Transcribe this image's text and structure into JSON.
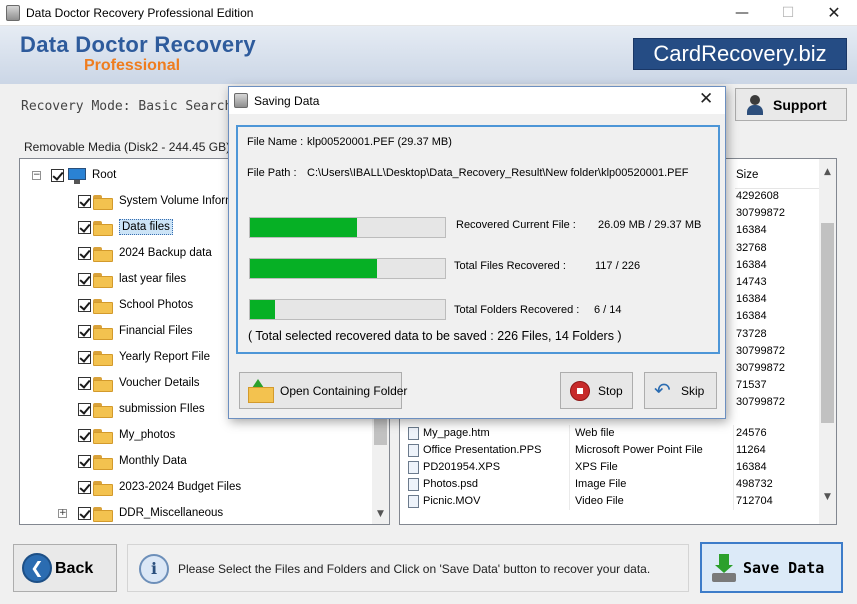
{
  "window": {
    "title": "Data Doctor Recovery Professional Edition",
    "minimize_glyph": "—",
    "maximize_glyph": "☐",
    "close_glyph": "✕"
  },
  "banner": {
    "brand_main": "Data Doctor Recovery",
    "brand_sub": "Professional",
    "site_badge": "CardRecovery.biz"
  },
  "header": {
    "recovery_mode": "Recovery Mode: Basic Search",
    "support_label": "Support"
  },
  "media_label": "Removable Media (Disk2 - 244.45 GB)",
  "tree": {
    "root": "Root",
    "expander_root": "−",
    "expander_last": "+",
    "items": [
      "System Volume Information",
      "Data files",
      "2024 Backup data",
      "last year files",
      "School Photos",
      "Financial Files",
      "Yearly Report File",
      "Voucher Details",
      "submission FIles",
      "My_photos",
      "Monthly Data",
      "2023-2024 Budget Files",
      "DDR_Miscellaneous"
    ],
    "selected_item": "Data files"
  },
  "file_list": {
    "size_header": "Size",
    "visible_sizes": [
      "4292608",
      "30799872",
      "16384",
      "32768",
      "16384",
      "14743",
      "16384",
      "16384",
      "73728",
      "30799872",
      "30799872",
      "71537",
      "30799872"
    ],
    "rows": [
      {
        "name": "My_page.htm",
        "type": "Web file",
        "size": "24576"
      },
      {
        "name": "Office Presentation.PPS",
        "type": "Microsoft Power Point File",
        "size": "11264"
      },
      {
        "name": "PD201954.XPS",
        "type": "XPS File",
        "size": "16384"
      },
      {
        "name": "Photos.psd",
        "type": "Image File",
        "size": "498732"
      },
      {
        "name": "Picnic.MOV",
        "type": "Video File",
        "size": "712704"
      }
    ]
  },
  "dialog": {
    "title": "Saving Data",
    "close_glyph": "✕",
    "file_name_label": "File Name :",
    "file_name_value": "klp00520001.PEF (29.37 MB)",
    "file_path_label": "File Path  :",
    "file_path_value": "C:\\Users\\IBALL\\Desktop\\Data_Recovery_Result\\New folder\\klp00520001.PEF",
    "progress": [
      {
        "label": "Recovered Current File :",
        "value": "26.09 MB /  29.37 MB",
        "fraction": 0.55
      },
      {
        "label": "Total Files Recovered :",
        "value": "117 / 226",
        "fraction": 0.65
      },
      {
        "label": "Total Folders Recovered :",
        "value": "6 / 14",
        "fraction": 0.13
      }
    ],
    "summary": "( Total selected recovered data to be saved : 226 Files, 14 Folders )",
    "open_folder_label": "Open Containing Folder",
    "stop_label": "Stop",
    "skip_label": "Skip"
  },
  "footer": {
    "back_label": "Back",
    "info_message": "Please Select the Files and Folders and Click on 'Save Data' button to recover your data.",
    "save_label": "Save Data",
    "info_glyph": "i",
    "back_glyph": "❮"
  },
  "scroll_glyphs": {
    "up": "▲",
    "down": "▼"
  },
  "colors": {
    "brand_blue": "#2e5b9c",
    "brand_orange": "#ef7d1f",
    "progress_green": "#06b025",
    "dialog_border": "#4d96d7"
  }
}
